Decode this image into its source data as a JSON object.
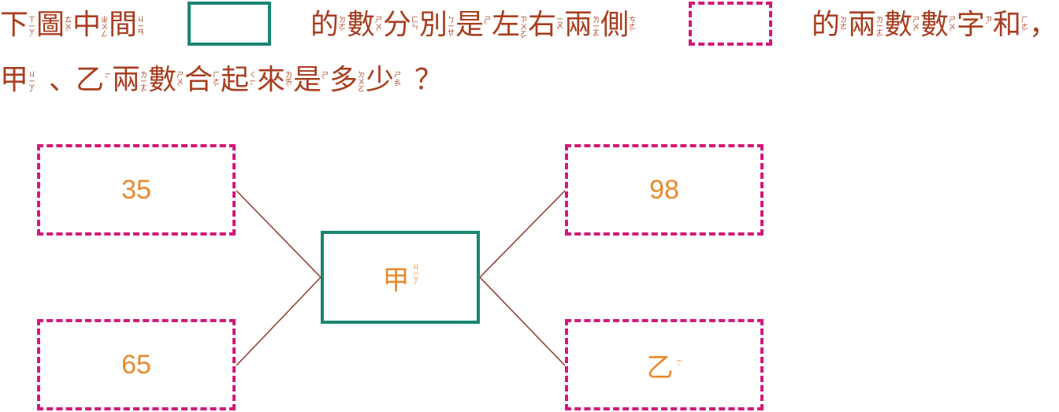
{
  "question": {
    "line1": [
      {
        "c": "下",
        "z": "ㄒㄧㄚˋ"
      },
      {
        "c": "圖",
        "z": "ㄊㄨˊ"
      },
      {
        "c": "中",
        "z": "ㄓㄨㄥ"
      },
      {
        "c": "間",
        "z": "ㄐㄧㄢ"
      },
      {
        "c": "的",
        "z": "ㄉㄜ˙"
      },
      {
        "c": "數",
        "z": "ㄕㄨˋ"
      },
      {
        "c": "分",
        "z": "ㄈㄣ"
      },
      {
        "c": "別",
        "z": "ㄅㄧㄝˊ"
      },
      {
        "c": "是",
        "z": "ㄕˋ"
      },
      {
        "c": "左",
        "z": "ㄗㄨㄛˇ"
      },
      {
        "c": "右",
        "z": "ㄧㄡˋ"
      },
      {
        "c": "兩",
        "z": "ㄌㄧㄤˇ"
      },
      {
        "c": "側",
        "z": "ㄘㄜˋ"
      },
      {
        "c": "的",
        "z": "ㄉㄜ˙"
      },
      {
        "c": "兩",
        "z": "ㄌㄧㄤˇ"
      },
      {
        "c": "數",
        "z": "ㄕㄨˋ"
      },
      {
        "c": "數",
        "z": "ㄕㄨˋ"
      },
      {
        "c": "字",
        "z": "ㄗˋ"
      },
      {
        "c": "和",
        "z": "ㄏㄜˊ"
      },
      {
        "c": "，",
        "z": ""
      }
    ],
    "line2": [
      {
        "c": "甲",
        "z": "ㄐㄧㄚˇ"
      },
      {
        "c": "、",
        "z": ""
      },
      {
        "c": "乙",
        "z": "ㄧˇ"
      },
      {
        "c": "兩",
        "z": "ㄌㄧㄤˇ"
      },
      {
        "c": "數",
        "z": "ㄕㄨˋ"
      },
      {
        "c": "合",
        "z": "ㄏㄜˊ"
      },
      {
        "c": "起",
        "z": "ㄑㄧˇ"
      },
      {
        "c": "來",
        "z": "ㄌㄞˊ"
      },
      {
        "c": "是",
        "z": "ㄕˋ"
      },
      {
        "c": "多",
        "z": "ㄉㄨㄛ"
      },
      {
        "c": "少",
        "z": "ㄕㄠˇ"
      },
      {
        "c": "？",
        "z": ""
      }
    ]
  },
  "diagram": {
    "top_left": "35",
    "bottom_left": "65",
    "top_right": "98",
    "bottom_right": {
      "c": "乙",
      "z": "ㄧˇ"
    },
    "center": {
      "c": "甲",
      "z": "ㄐㄧㄚˇ"
    }
  },
  "colors": {
    "text": "#a83e1f",
    "number": "#e8892d",
    "solid_box": "#1a8672",
    "dashed_box": "#d11a7a",
    "connector": "#8b3a2e"
  }
}
